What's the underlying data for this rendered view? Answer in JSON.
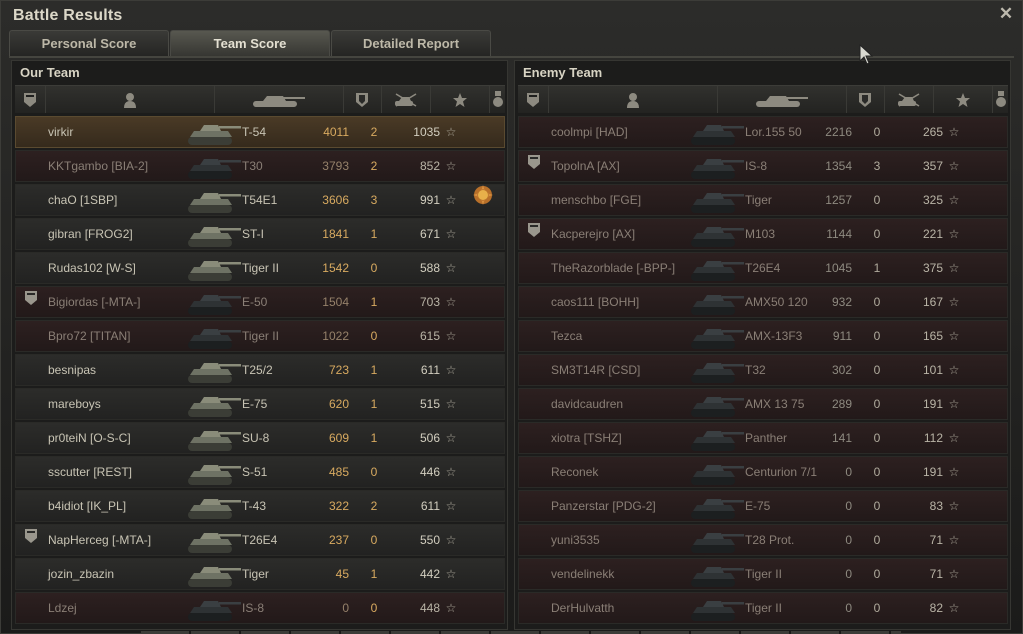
{
  "window": {
    "title": "Battle Results"
  },
  "tabs": [
    {
      "label": "Personal Score",
      "active": false
    },
    {
      "label": "Team Score",
      "active": true
    },
    {
      "label": "Detailed Report",
      "active": false
    }
  ],
  "headers": [
    "platoon-icon",
    "player-icon",
    "tank-icon",
    "damage-icon",
    "kills-icon",
    "star-icon",
    "medal-icon"
  ],
  "colors": {
    "player_row": "#4a3a26",
    "destroyed_row": "#2d2020",
    "alive_row": "#2c2c2a",
    "damage_text": "#d8aa60"
  },
  "our_team": {
    "title": "Our Team",
    "rows": [
      {
        "name": "virkir",
        "tank": "T-54",
        "damage": "4011",
        "kills": "2",
        "xp": "1035",
        "star": "☆",
        "state": "player",
        "platoon": false,
        "medal": false
      },
      {
        "name": "KKTgambo [BIA-2]",
        "tank": "T30",
        "damage": "3793",
        "kills": "2",
        "xp": "852",
        "star": "☆",
        "state": "dead",
        "platoon": false,
        "medal": false
      },
      {
        "name": "chaO [1SBP]",
        "tank": "T54E1",
        "damage": "3606",
        "kills": "3",
        "xp": "991",
        "star": "☆",
        "state": "alive",
        "platoon": false,
        "medal": true
      },
      {
        "name": "gibran [FROG2]",
        "tank": "ST-I",
        "damage": "1841",
        "kills": "1",
        "xp": "671",
        "star": "☆",
        "state": "alive",
        "platoon": false,
        "medal": false
      },
      {
        "name": "Rudas102 [W-S]",
        "tank": "Tiger II",
        "damage": "1542",
        "kills": "0",
        "xp": "588",
        "star": "☆",
        "state": "alive",
        "platoon": false,
        "medal": false
      },
      {
        "name": "Bigiordas [-MTA-]",
        "tank": "E-50",
        "damage": "1504",
        "kills": "1",
        "xp": "703",
        "star": "☆",
        "state": "dead",
        "platoon": true,
        "medal": false
      },
      {
        "name": "Bpro72 [TITAN]",
        "tank": "Tiger II",
        "damage": "1022",
        "kills": "0",
        "xp": "615",
        "star": "☆",
        "state": "dead",
        "platoon": false,
        "medal": false
      },
      {
        "name": "besnipas",
        "tank": "T25/2",
        "damage": "723",
        "kills": "1",
        "xp": "611",
        "star": "☆",
        "state": "alive",
        "platoon": false,
        "medal": false
      },
      {
        "name": "mareboys",
        "tank": "E-75",
        "damage": "620",
        "kills": "1",
        "xp": "515",
        "star": "☆",
        "state": "alive",
        "platoon": false,
        "medal": false
      },
      {
        "name": "pr0teiN [O-S-C]",
        "tank": "SU-8",
        "damage": "609",
        "kills": "1",
        "xp": "506",
        "star": "☆",
        "state": "alive",
        "platoon": false,
        "medal": false
      },
      {
        "name": "sscutter [REST]",
        "tank": "S-51",
        "damage": "485",
        "kills": "0",
        "xp": "446",
        "star": "☆",
        "state": "alive",
        "platoon": false,
        "medal": false
      },
      {
        "name": "b4idiot [IK_PL]",
        "tank": "T-43",
        "damage": "322",
        "kills": "2",
        "xp": "611",
        "star": "☆",
        "state": "alive",
        "platoon": false,
        "medal": false
      },
      {
        "name": "NapHerceg [-MTA-]",
        "tank": "T26E4",
        "damage": "237",
        "kills": "0",
        "xp": "550",
        "star": "☆",
        "state": "alive",
        "platoon": true,
        "medal": false
      },
      {
        "name": "jozin_zbazin",
        "tank": "Tiger",
        "damage": "45",
        "kills": "1",
        "xp": "442",
        "star": "☆",
        "state": "alive",
        "platoon": false,
        "medal": false
      },
      {
        "name": "Ldzej",
        "tank": "IS-8",
        "damage": "0",
        "kills": "0",
        "xp": "448",
        "star": "☆",
        "state": "dead",
        "platoon": false,
        "medal": false
      }
    ]
  },
  "enemy_team": {
    "title": "Enemy Team",
    "rows": [
      {
        "name": "coolmpi [HAD]",
        "tank": "Lor.155 50",
        "damage": "2216",
        "kills": "0",
        "xp": "265",
        "star": "☆",
        "state": "dead",
        "platoon": false,
        "medal": false
      },
      {
        "name": "TopolnA [AX]",
        "tank": "IS-8",
        "damage": "1354",
        "kills": "3",
        "xp": "357",
        "star": "☆",
        "state": "dead",
        "platoon": true,
        "medal": false
      },
      {
        "name": "menschbo [FGE]",
        "tank": "Tiger",
        "damage": "1257",
        "kills": "0",
        "xp": "325",
        "star": "☆",
        "state": "dead",
        "platoon": false,
        "medal": false
      },
      {
        "name": "Kacperejro [AX]",
        "tank": "M103",
        "damage": "1144",
        "kills": "0",
        "xp": "221",
        "star": "☆",
        "state": "dead",
        "platoon": true,
        "medal": false
      },
      {
        "name": "TheRazorblade [-BPP-]",
        "tank": "T26E4",
        "damage": "1045",
        "kills": "1",
        "xp": "375",
        "star": "☆",
        "state": "dead",
        "platoon": false,
        "medal": false
      },
      {
        "name": "caos111 [BOHH]",
        "tank": "AMX50 120",
        "damage": "932",
        "kills": "0",
        "xp": "167",
        "star": "☆",
        "state": "dead",
        "platoon": false,
        "medal": false
      },
      {
        "name": "Tezca",
        "tank": "AMX-13F3",
        "damage": "911",
        "kills": "0",
        "xp": "165",
        "star": "☆",
        "state": "dead",
        "platoon": false,
        "medal": false
      },
      {
        "name": "SM3T14R [CSD]",
        "tank": "T32",
        "damage": "302",
        "kills": "0",
        "xp": "101",
        "star": "☆",
        "state": "dead",
        "platoon": false,
        "medal": false
      },
      {
        "name": "davidcaudren",
        "tank": "AMX 13 75",
        "damage": "289",
        "kills": "0",
        "xp": "191",
        "star": "☆",
        "state": "dead",
        "platoon": false,
        "medal": false
      },
      {
        "name": "xiotra [TSHZ]",
        "tank": "Panther",
        "damage": "141",
        "kills": "0",
        "xp": "112",
        "star": "☆",
        "state": "dead",
        "platoon": false,
        "medal": false
      },
      {
        "name": "Reconek",
        "tank": "Centurion 7/1",
        "damage": "0",
        "kills": "0",
        "xp": "191",
        "star": "☆",
        "state": "dead",
        "platoon": false,
        "medal": false
      },
      {
        "name": "Panzerstar [PDG-2]",
        "tank": "E-75",
        "damage": "0",
        "kills": "0",
        "xp": "83",
        "star": "☆",
        "state": "dead",
        "platoon": false,
        "medal": false
      },
      {
        "name": "yuni3535",
        "tank": "T28 Prot.",
        "damage": "0",
        "kills": "0",
        "xp": "71",
        "star": "☆",
        "state": "dead",
        "platoon": false,
        "medal": false
      },
      {
        "name": "vendelinekk",
        "tank": "Tiger II",
        "damage": "0",
        "kills": "0",
        "xp": "71",
        "star": "☆",
        "state": "dead",
        "platoon": false,
        "medal": false
      },
      {
        "name": "DerHulvatth",
        "tank": "Tiger II",
        "damage": "0",
        "kills": "0",
        "xp": "82",
        "star": "☆",
        "state": "dead",
        "platoon": false,
        "medal": false
      }
    ]
  }
}
